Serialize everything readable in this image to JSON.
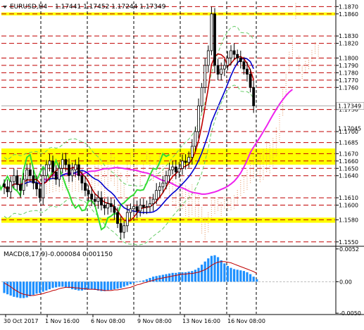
{
  "header": {
    "symbol_label": "EURUSD,H4",
    "ohlc_label": "1.17441 1.17452 1.17244 1.17349"
  },
  "indicator": {
    "label": "MACD(8,17,9)",
    "values_label": "-0.000084 0.001150"
  },
  "colors": {
    "background": "#ffffff",
    "candle": "#000000",
    "resistance_line": "#c00000",
    "yellow_zone": "#ffff00",
    "tenkan": "#c00000",
    "kijun": "#0000cc",
    "chikou": "#33dd33",
    "senkou_b": "#ee22ee",
    "cloud_dots": "#e8a070",
    "envelope": "#66cc66",
    "macd_hist": "#1e90ff",
    "macd_signal": "#c00000",
    "current_price_line": "#aaaaaa"
  },
  "chart_data": [
    {
      "type": "candlestick",
      "name": "EURUSD,H4",
      "ylim": [
        1.1545,
        1.1877
      ],
      "y_ticks": [
        "1.1870",
        "1.1860",
        "1.1830",
        "1.1820",
        "1.1800",
        "1.1790",
        "1.1780",
        "1.1770",
        "1.1760",
        "1.1730",
        "1.1700",
        "1.1685",
        "1.1670",
        "1.1660",
        "1.1650",
        "1.1640",
        "1.1610",
        "1.1600",
        "1.1580",
        "1.1550"
      ],
      "x_ticks": [
        "30 Oct 2017",
        "1 Nov 16:00",
        "6 Nov 08:00",
        "9 Nov 08:00",
        "13 Nov 16:00",
        "16 Nov 08:00"
      ],
      "current_price": "1.17349",
      "extra_price_tags": [
        "1.17045"
      ],
      "resistance_levels": [
        1.187,
        1.186,
        1.183,
        1.182,
        1.18,
        1.179,
        1.178,
        1.177,
        1.176,
        1.173,
        1.17,
        1.1685,
        1.167,
        1.166,
        1.165,
        1.164,
        1.161,
        1.16,
        1.158,
        1.155
      ],
      "yellow_zones": [
        [
          1.1858,
          1.1862
        ],
        [
          1.1655,
          1.1677
        ],
        [
          1.1576,
          1.1583
        ]
      ],
      "close_series": [
        1.1625,
        1.1618,
        1.1632,
        1.164,
        1.1628,
        1.162,
        1.1635,
        1.1648,
        1.164,
        1.163,
        1.1622,
        1.161,
        1.164,
        1.1655,
        1.166,
        1.1645,
        1.1635,
        1.165,
        1.1662,
        1.1655,
        1.164,
        1.1648,
        1.1655,
        1.164,
        1.163,
        1.162,
        1.1615,
        1.1608,
        1.1605,
        1.161,
        1.16,
        1.1596,
        1.1602,
        1.1598,
        1.159,
        1.1575,
        1.1563,
        1.1572,
        1.159,
        1.1595,
        1.1598,
        1.1592,
        1.16,
        1.1597,
        1.1598,
        1.1602,
        1.1608,
        1.162,
        1.1625,
        1.163,
        1.164,
        1.1648,
        1.1652,
        1.1645,
        1.165,
        1.166,
        1.1658,
        1.1665,
        1.168,
        1.17,
        1.1735,
        1.176,
        1.179,
        1.181,
        1.186,
        1.179,
        1.1778,
        1.1785,
        1.179,
        1.18,
        1.181,
        1.1805,
        1.18,
        1.1795,
        1.1785,
        1.1778,
        1.176,
        1.1735
      ]
    },
    {
      "type": "bar",
      "name": "MACD(8,17,9)",
      "ylim": [
        -0.0051,
        0.0054
      ],
      "y_ticks": [
        "0.0052",
        "0.00",
        "-0.0050"
      ],
      "histogram": [
        -0.0018,
        -0.002,
        -0.0022,
        -0.0024,
        -0.0025,
        -0.0026,
        -0.0026,
        -0.0025,
        -0.0023,
        -0.0021,
        -0.0019,
        -0.0018,
        -0.0016,
        -0.0014,
        -0.0012,
        -0.001,
        -0.0009,
        -0.0008,
        -0.0008,
        -0.0009,
        -0.001,
        -0.0012,
        -0.0013,
        -0.0014,
        -0.0014,
        -0.0013,
        -0.0012,
        -0.0012,
        -0.0013,
        -0.0014,
        -0.0015,
        -0.0015,
        -0.0014,
        -0.0013,
        -0.0012,
        -0.0011,
        -0.001,
        -0.0008,
        -0.0006,
        -0.0004,
        -0.0002,
        0.0,
        0.0001,
        0.0002,
        0.0004,
        0.0006,
        0.0008,
        0.0009,
        0.001,
        0.0011,
        0.0012,
        0.0013,
        0.0014,
        0.0014,
        0.0015,
        0.0015,
        0.0015,
        0.0016,
        0.0017,
        0.0019,
        0.0022,
        0.0027,
        0.0032,
        0.0037,
        0.0041,
        0.0042,
        0.0039,
        0.0034,
        0.0029,
        0.0025,
        0.0022,
        0.002,
        0.0019,
        0.0018,
        0.0017,
        0.0015,
        0.0012,
        0.0008,
        0.0004
      ],
      "signal": [
        -0.0002,
        -0.0005,
        -0.0008,
        -0.0012,
        -0.0015,
        -0.0018,
        -0.002,
        -0.0021,
        -0.0022,
        -0.0022,
        -0.0021,
        -0.002,
        -0.0019,
        -0.0017,
        -0.0016,
        -0.0014,
        -0.0013,
        -0.0011,
        -0.001,
        -0.0009,
        -0.0009,
        -0.0009,
        -0.001,
        -0.001,
        -0.0011,
        -0.0011,
        -0.0012,
        -0.0012,
        -0.0012,
        -0.0013,
        -0.0013,
        -0.0014,
        -0.0014,
        -0.0014,
        -0.0013,
        -0.0013,
        -0.0012,
        -0.0011,
        -0.001,
        -0.0009,
        -0.0007,
        -0.0005,
        -0.0004,
        -0.0002,
        -0.0001,
        0.0001,
        0.0002,
        0.0004,
        0.0005,
        0.0006,
        0.0007,
        0.0008,
        0.0009,
        0.001,
        0.0011,
        0.0012,
        0.0012,
        0.0013,
        0.0013,
        0.0014,
        0.0015,
        0.0017,
        0.0019,
        0.0022,
        0.0026,
        0.0029,
        0.0031,
        0.0032,
        0.0032,
        0.0031,
        0.003,
        0.0028,
        0.0026,
        0.0024,
        0.0022,
        0.002,
        0.0018,
        0.0016,
        0.0013
      ]
    }
  ]
}
